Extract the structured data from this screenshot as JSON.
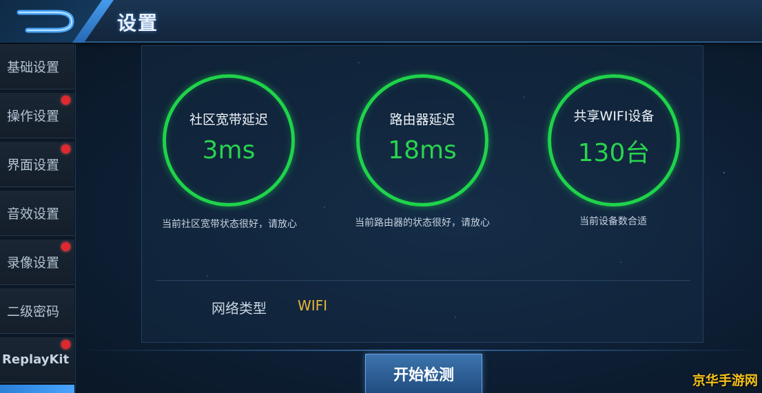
{
  "header": {
    "title": "设置",
    "back_icon": "back-arrow-icon",
    "accent": "#4aa7ff"
  },
  "sidebar": {
    "items": [
      {
        "label": "基础设置",
        "badge": false
      },
      {
        "label": "操作设置",
        "badge": true
      },
      {
        "label": "界面设置",
        "badge": true
      },
      {
        "label": "音效设置",
        "badge": false
      },
      {
        "label": "录像设置",
        "badge": true
      },
      {
        "label": "二级密码",
        "badge": false
      },
      {
        "label": "ReplayKit",
        "badge": true
      }
    ],
    "badge_color": "#e0282e"
  },
  "gauges": [
    {
      "label": "社区宽带延迟",
      "value": "3ms",
      "desc": "当前社区宽带状态很好，请放心"
    },
    {
      "label": "路由器延迟",
      "value": "18ms",
      "desc": "当前路由器的状态很好，请放心"
    },
    {
      "label": "共享WIFI设备",
      "value": "130台",
      "desc": "当前设备数合适"
    }
  ],
  "gauge_color": "#1fd34a",
  "network": {
    "label": "网络类型",
    "value": "WIFI",
    "value_color": "#e5b63a"
  },
  "actions": {
    "start_label": "开始检测"
  },
  "watermark": "京华手游网"
}
